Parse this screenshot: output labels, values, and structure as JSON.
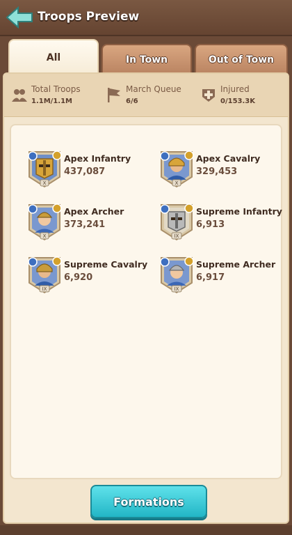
{
  "header": {
    "title": "Troops Preview",
    "back_icon": "back-arrow-icon"
  },
  "tabs": [
    {
      "label": "All",
      "active": true
    },
    {
      "label": "In Town",
      "active": false
    },
    {
      "label": "Out of Town",
      "active": false
    }
  ],
  "stats": {
    "total": {
      "label": "Total Troops",
      "value": "1.1M/1.1M",
      "icon": "troops-icon"
    },
    "march": {
      "label": "March Queue",
      "value": "6/6",
      "icon": "flag-icon"
    },
    "injured": {
      "label": "Injured",
      "value": "0/153.3K",
      "icon": "medical-cross-icon"
    }
  },
  "troops": [
    {
      "name": "Apex Infantry",
      "count": "437,087",
      "tier": "X",
      "icon": "infantry-portrait-icon"
    },
    {
      "name": "Apex Cavalry",
      "count": "329,453",
      "tier": "X",
      "icon": "cavalry-portrait-icon"
    },
    {
      "name": "Apex Archer",
      "count": "373,241",
      "tier": "X",
      "icon": "archer-portrait-icon"
    },
    {
      "name": "Supreme Infantry",
      "count": "6,913",
      "tier": "IX",
      "icon": "infantry-portrait-icon"
    },
    {
      "name": "Supreme Cavalry",
      "count": "6,920",
      "tier": "IX",
      "icon": "cavalry-portrait-icon"
    },
    {
      "name": "Supreme Archer",
      "count": "6,917",
      "tier": "IX",
      "icon": "archer-portrait-icon"
    }
  ],
  "formations_button": {
    "label": "Formations"
  },
  "colors": {
    "accent": "#22b6c6",
    "brown": "#6b4a37",
    "panel": "#f3e6cf"
  }
}
